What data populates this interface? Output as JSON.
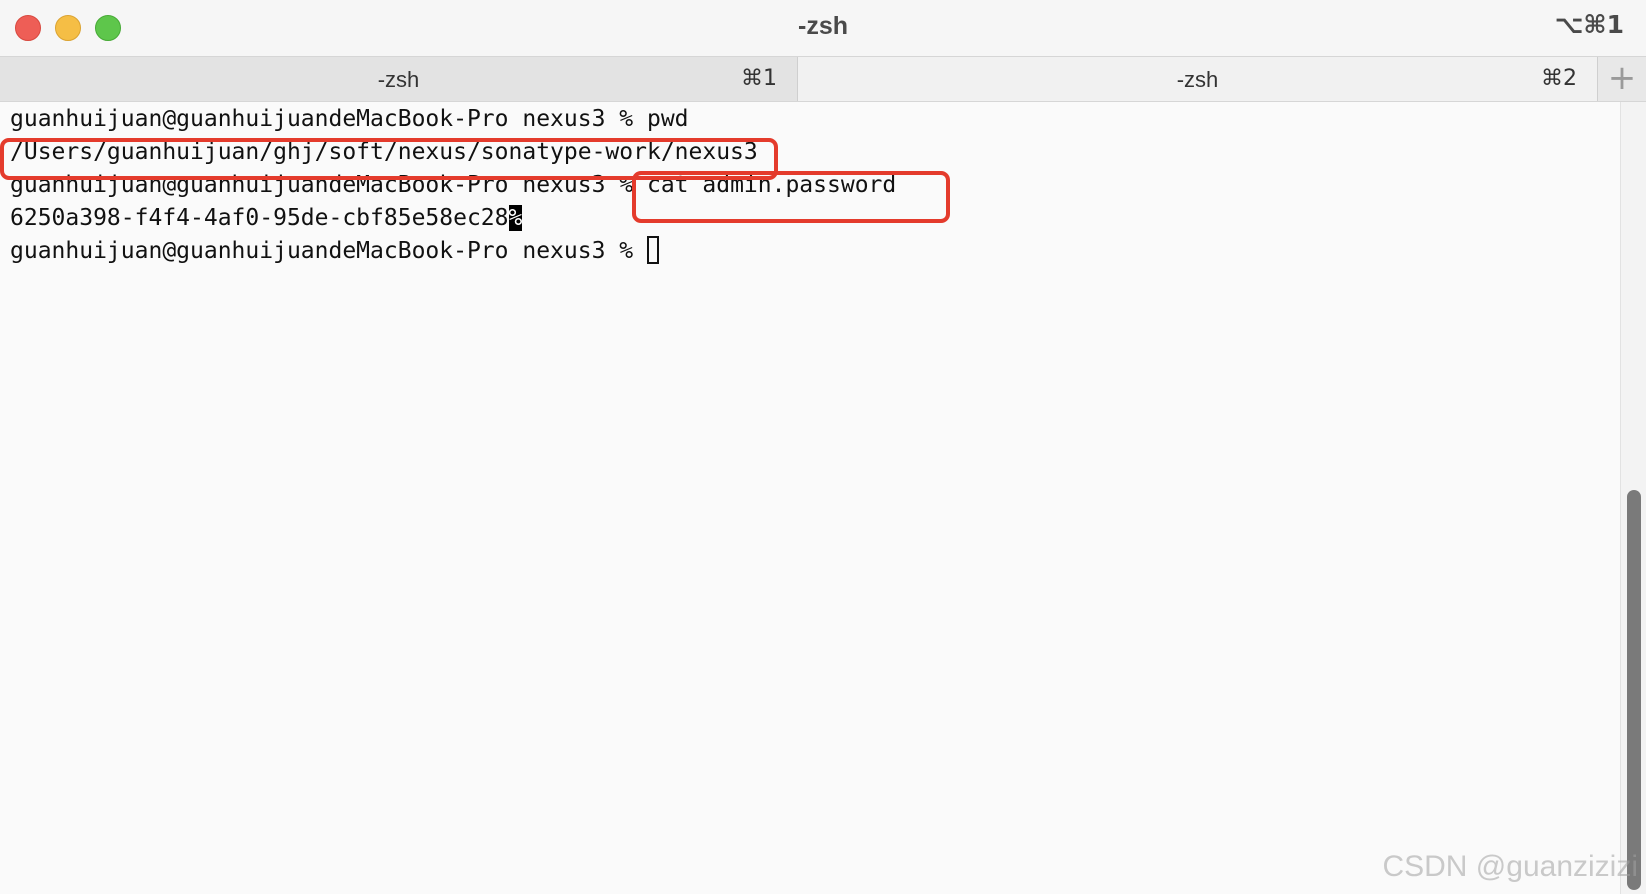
{
  "window": {
    "title": "-zsh",
    "shortcut": "⌥⌘1"
  },
  "tabs": [
    {
      "label": "-zsh",
      "shortcut": "⌘1",
      "active": true
    },
    {
      "label": "-zsh",
      "shortcut": "⌘2",
      "active": false
    }
  ],
  "new_tab": {
    "symbol": "+"
  },
  "terminal": {
    "lines": [
      {
        "prompt": "guanhuijuan@guanhuijuandeMacBook-Pro nexus3 % ",
        "command": "pwd"
      },
      {
        "output": "/Users/guanhuijuan/ghj/soft/nexus/sonatype-work/nexus3"
      },
      {
        "prompt": "guanhuijuan@guanhuijuandeMacBook-Pro nexus3 % ",
        "command": "cat admin.password"
      },
      {
        "output": "6250a398-f4f4-4af0-95de-cbf85e58ec28",
        "eol_marker": "%"
      },
      {
        "prompt": "guanhuijuan@guanhuijuandeMacBook-Pro nexus3 % ",
        "command": ""
      }
    ]
  },
  "watermark": "CSDN @guanzizizi",
  "colors": {
    "close": "#ee5e56",
    "minimize": "#f5be45",
    "maximize": "#5ec64b",
    "annotation": "#e43b2c"
  },
  "scrollbar": {
    "position": 0.5,
    "visible_fraction": 0.5
  }
}
